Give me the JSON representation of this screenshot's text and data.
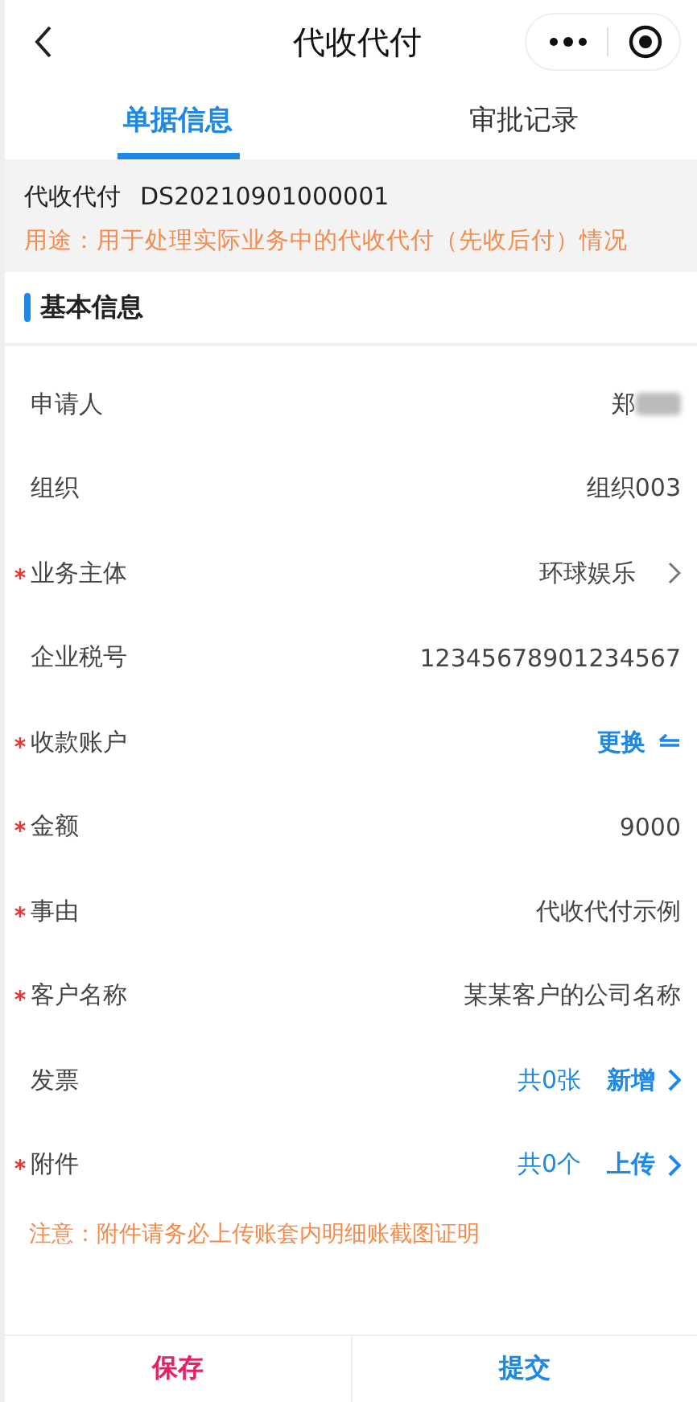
{
  "nav": {
    "title": "代收代付"
  },
  "tabs": [
    {
      "label": "单据信息",
      "selected": true
    },
    {
      "label": "审批记录",
      "selected": false
    }
  ],
  "summary": {
    "type": "代收代付",
    "number": "DS20210901000001",
    "purpose": "用途：用于处理实际业务中的代收代付（先收后付）情况"
  },
  "section": {
    "title": "基本信息"
  },
  "fields": [
    {
      "kind": "text",
      "label": "申请人",
      "required": false,
      "value": "郑",
      "redacted": true
    },
    {
      "kind": "text",
      "label": "组织",
      "required": false,
      "value": "组织003"
    },
    {
      "kind": "select",
      "label": "业务主体",
      "required": true,
      "value": "环球娱乐"
    },
    {
      "kind": "text",
      "label": "企业税号",
      "required": false,
      "value": "12345678901234567"
    },
    {
      "kind": "action",
      "label": "收款账户",
      "required": true,
      "action": "更换"
    },
    {
      "kind": "text",
      "label": "金额",
      "required": true,
      "value": "9000"
    },
    {
      "kind": "text",
      "label": "事由",
      "required": true,
      "value": "代收代付示例"
    },
    {
      "kind": "text",
      "label": "客户名称",
      "required": true,
      "value": "某某客户的公司名称"
    },
    {
      "kind": "count",
      "label": "发票",
      "required": false,
      "count": "共0张",
      "action": "新增"
    },
    {
      "kind": "count",
      "label": "附件",
      "required": true,
      "count": "共0个",
      "action": "上传"
    }
  ],
  "note": "注意：附件请务必上传账套内明细账截图证明",
  "buttons": [
    {
      "label": "保存",
      "kind": "secondary"
    },
    {
      "label": "提交",
      "kind": "primary"
    }
  ]
}
